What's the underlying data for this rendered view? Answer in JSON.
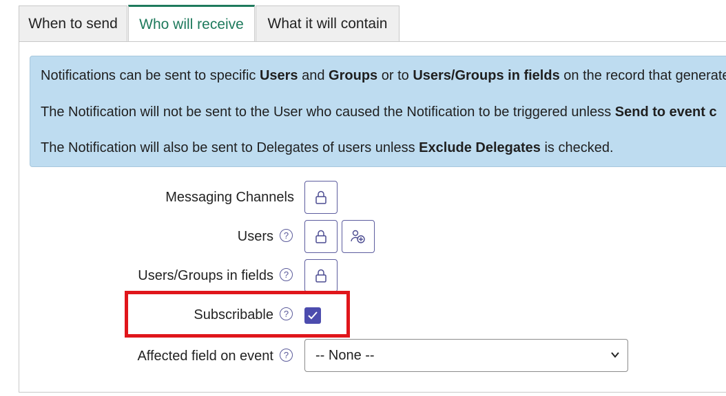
{
  "tabs": [
    {
      "label": "When to send"
    },
    {
      "label": "Who will receive"
    },
    {
      "label": "What it will contain"
    }
  ],
  "info": {
    "line1": {
      "a": "Notifications can be sent to specific ",
      "b": "Users",
      "c": " and ",
      "d": "Groups",
      "e": " or to ",
      "f": "Users/Groups in fields",
      "g": " on the record that generate"
    },
    "line2": {
      "a": "The Notification will not be sent to the User who caused the Notification to be triggered unless ",
      "b": "Send to event c"
    },
    "line3": {
      "a": "The Notification will also be sent to Delegates of users unless ",
      "b": "Exclude Delegates",
      "c": " is checked."
    }
  },
  "form": {
    "messaging_channels": "Messaging Channels",
    "users": "Users",
    "users_groups_fields": "Users/Groups in fields",
    "subscribable": "Subscribable",
    "affected_field": "Affected field on event",
    "affected_field_value": "-- None --"
  },
  "state": {
    "subscribable_checked": true
  },
  "colors": {
    "active_tab": "#1e7a5c",
    "info_bg": "#bedcf0",
    "accent": "#4c4cae",
    "highlight": "#e0161b"
  },
  "icons": [
    "lock-icon",
    "add-user-icon",
    "help-icon",
    "check-icon",
    "chevron-down-icon"
  ]
}
